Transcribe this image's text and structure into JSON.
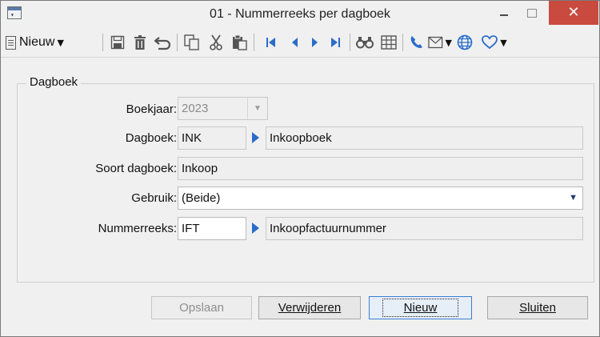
{
  "window": {
    "title": "01 - Nummerreeks per dagboek",
    "close_glyph": "✕"
  },
  "toolbar": {
    "new_label": "Nieuw",
    "icons": [
      "save-icon",
      "delete-icon",
      "undo-icon",
      "copy-icon",
      "cut-icon",
      "paste-icon",
      "first-record-icon",
      "previous-record-icon",
      "next-record-icon",
      "last-record-icon",
      "find-icon",
      "grid-icon",
      "phone-icon",
      "mail-icon",
      "globe-icon",
      "heart-icon"
    ]
  },
  "form": {
    "group_title": "Dagboek",
    "boekjaar_label": "Boekjaar:",
    "boekjaar_value": "2023",
    "dagboek_label": "Dagboek:",
    "dagboek_code": "INK",
    "dagboek_name": "Inkoopboek",
    "soort_label": "Soort dagboek:",
    "soort_value": "Inkoop",
    "gebruik_label": "Gebruik:",
    "gebruik_value": "(Beide)",
    "nummerreeks_label": "Nummerreeks:",
    "nummerreeks_code": "IFT",
    "nummerreeks_name": "Inkoopfactuurnummer"
  },
  "buttons": {
    "save": "Opslaan",
    "delete": "Verwijderen",
    "new": "Nieuw",
    "close": "Sluiten"
  },
  "colors": {
    "close_button": "#c94a3f",
    "accent_blue": "#2a6cc9",
    "dialog_background": "#f0f0f0"
  }
}
